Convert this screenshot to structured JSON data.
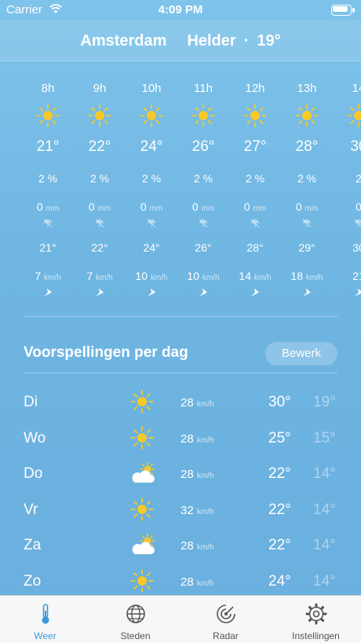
{
  "status_bar": {
    "carrier": "Carrier",
    "time": "4:09 PM"
  },
  "header": {
    "city": "Amsterdam",
    "condition": "Helder",
    "separator": "·",
    "temperature": "19°"
  },
  "hourly": [
    {
      "time": "8h",
      "icon": "sun-icon",
      "temp": "21°",
      "precip_chance": "2 %",
      "rain": "0",
      "rain_unit": "mm",
      "feels_like": "21°",
      "wind": "7",
      "wind_unit": "km/h"
    },
    {
      "time": "9h",
      "icon": "sun-icon",
      "temp": "22°",
      "precip_chance": "2 %",
      "rain": "0",
      "rain_unit": "mm",
      "feels_like": "22°",
      "wind": "7",
      "wind_unit": "km/h"
    },
    {
      "time": "10h",
      "icon": "sun-icon",
      "temp": "24°",
      "precip_chance": "2 %",
      "rain": "0",
      "rain_unit": "mm",
      "feels_like": "24°",
      "wind": "10",
      "wind_unit": "km/h"
    },
    {
      "time": "11h",
      "icon": "sun-icon",
      "temp": "26°",
      "precip_chance": "2 %",
      "rain": "0",
      "rain_unit": "mm",
      "feels_like": "26°",
      "wind": "10",
      "wind_unit": "km/h"
    },
    {
      "time": "12h",
      "icon": "sun-icon",
      "temp": "27°",
      "precip_chance": "2 %",
      "rain": "0",
      "rain_unit": "mm",
      "feels_like": "28°",
      "wind": "14",
      "wind_unit": "km/h"
    },
    {
      "time": "13h",
      "icon": "sun-icon",
      "temp": "28°",
      "precip_chance": "2 %",
      "rain": "0",
      "rain_unit": "mm",
      "feels_like": "29°",
      "wind": "18",
      "wind_unit": "km/h"
    },
    {
      "time": "14",
      "icon": "sun-icon",
      "temp": "30",
      "precip_chance": "2",
      "rain": "0",
      "rain_unit": "",
      "feels_like": "30",
      "wind": "21",
      "wind_unit": ""
    }
  ],
  "daily": {
    "title": "Voorspellingen per dag",
    "edit_label": "Bewerk",
    "days": [
      {
        "day": "Di",
        "icon": "sun-icon",
        "wind": "28",
        "wind_unit": "km/h",
        "high": "30°",
        "low": "19°"
      },
      {
        "day": "Wo",
        "icon": "sun-icon",
        "wind": "28",
        "wind_unit": "km/h",
        "high": "25°",
        "low": "15°"
      },
      {
        "day": "Do",
        "icon": "partly-cloudy-icon",
        "wind": "28",
        "wind_unit": "km/h",
        "high": "22°",
        "low": "14°"
      },
      {
        "day": "Vr",
        "icon": "sun-icon",
        "wind": "32",
        "wind_unit": "km/h",
        "high": "22°",
        "low": "14°"
      },
      {
        "day": "Za",
        "icon": "partly-cloudy-icon",
        "wind": "28",
        "wind_unit": "km/h",
        "high": "22°",
        "low": "14°"
      },
      {
        "day": "Zo",
        "icon": "sun-icon",
        "wind": "28",
        "wind_unit": "km/h",
        "high": "24°",
        "low": "14°"
      }
    ]
  },
  "tabbar": {
    "active_color": "#3a9ad9",
    "tabs": [
      {
        "label": "Weer",
        "icon": "thermometer-icon",
        "active": true
      },
      {
        "label": "Steden",
        "icon": "globe-icon",
        "active": false
      },
      {
        "label": "Radar",
        "icon": "radar-icon",
        "active": false
      },
      {
        "label": "Instellingen",
        "icon": "gear-icon",
        "active": false
      }
    ]
  },
  "colors": {
    "sun": "#f7c928",
    "background": "#6fb6e2"
  }
}
